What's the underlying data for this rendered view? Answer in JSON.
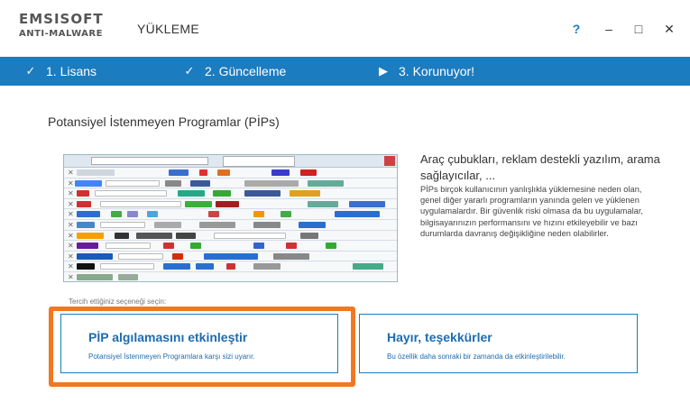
{
  "app": {
    "logo_line1": "EMSISOFT",
    "logo_line2": "ANTI-MALWARE",
    "screen_title": "YÜKLEME"
  },
  "window_controls": {
    "help": "?",
    "minimize": "–",
    "maximize": "□",
    "close": "✕"
  },
  "steps": [
    {
      "label": "1. Lisans",
      "icon": "check-icon",
      "glyph": "✓"
    },
    {
      "label": "2. Güncelleme",
      "icon": "check-icon",
      "glyph": "✓"
    },
    {
      "label": "3. Korunuyor!",
      "icon": "play-arrow-icon",
      "glyph": "▶"
    }
  ],
  "content": {
    "heading": "Potansiyel İstenmeyen Programlar (PİPs)",
    "desc_title": "Araç çubukları, reklam destekli yazılım, arama sağlayıcılar, ...",
    "desc_body": "PİPs birçok kullanıcının yanlışlıkla yüklemesine neden olan, genel diğer yararlı programların yanında gelen ve yüklenen uygulamalardır. Bir güvenlik riski olmasa da bu uygulamalar, bilgisayarınızın performansını ve hızını etkileyebilir ve bazı durumlarda davranış değişikliğine neden olabilirler.",
    "faded_text": "Tercih ettiğiniz seçeneği seçin:"
  },
  "options": {
    "enable": {
      "title": "PİP algılamasını etkinleştir",
      "subtitle": "Potansiyel İstenmeyen Programlara karşı sizi uyarır."
    },
    "decline": {
      "title": "Hayır, teşekkürler",
      "subtitle": "Bu özellik daha sonraki bir zamanda da etkinleştirilebilir."
    }
  },
  "colors": {
    "accent": "#1c7cc0",
    "highlight": "#f07820"
  }
}
